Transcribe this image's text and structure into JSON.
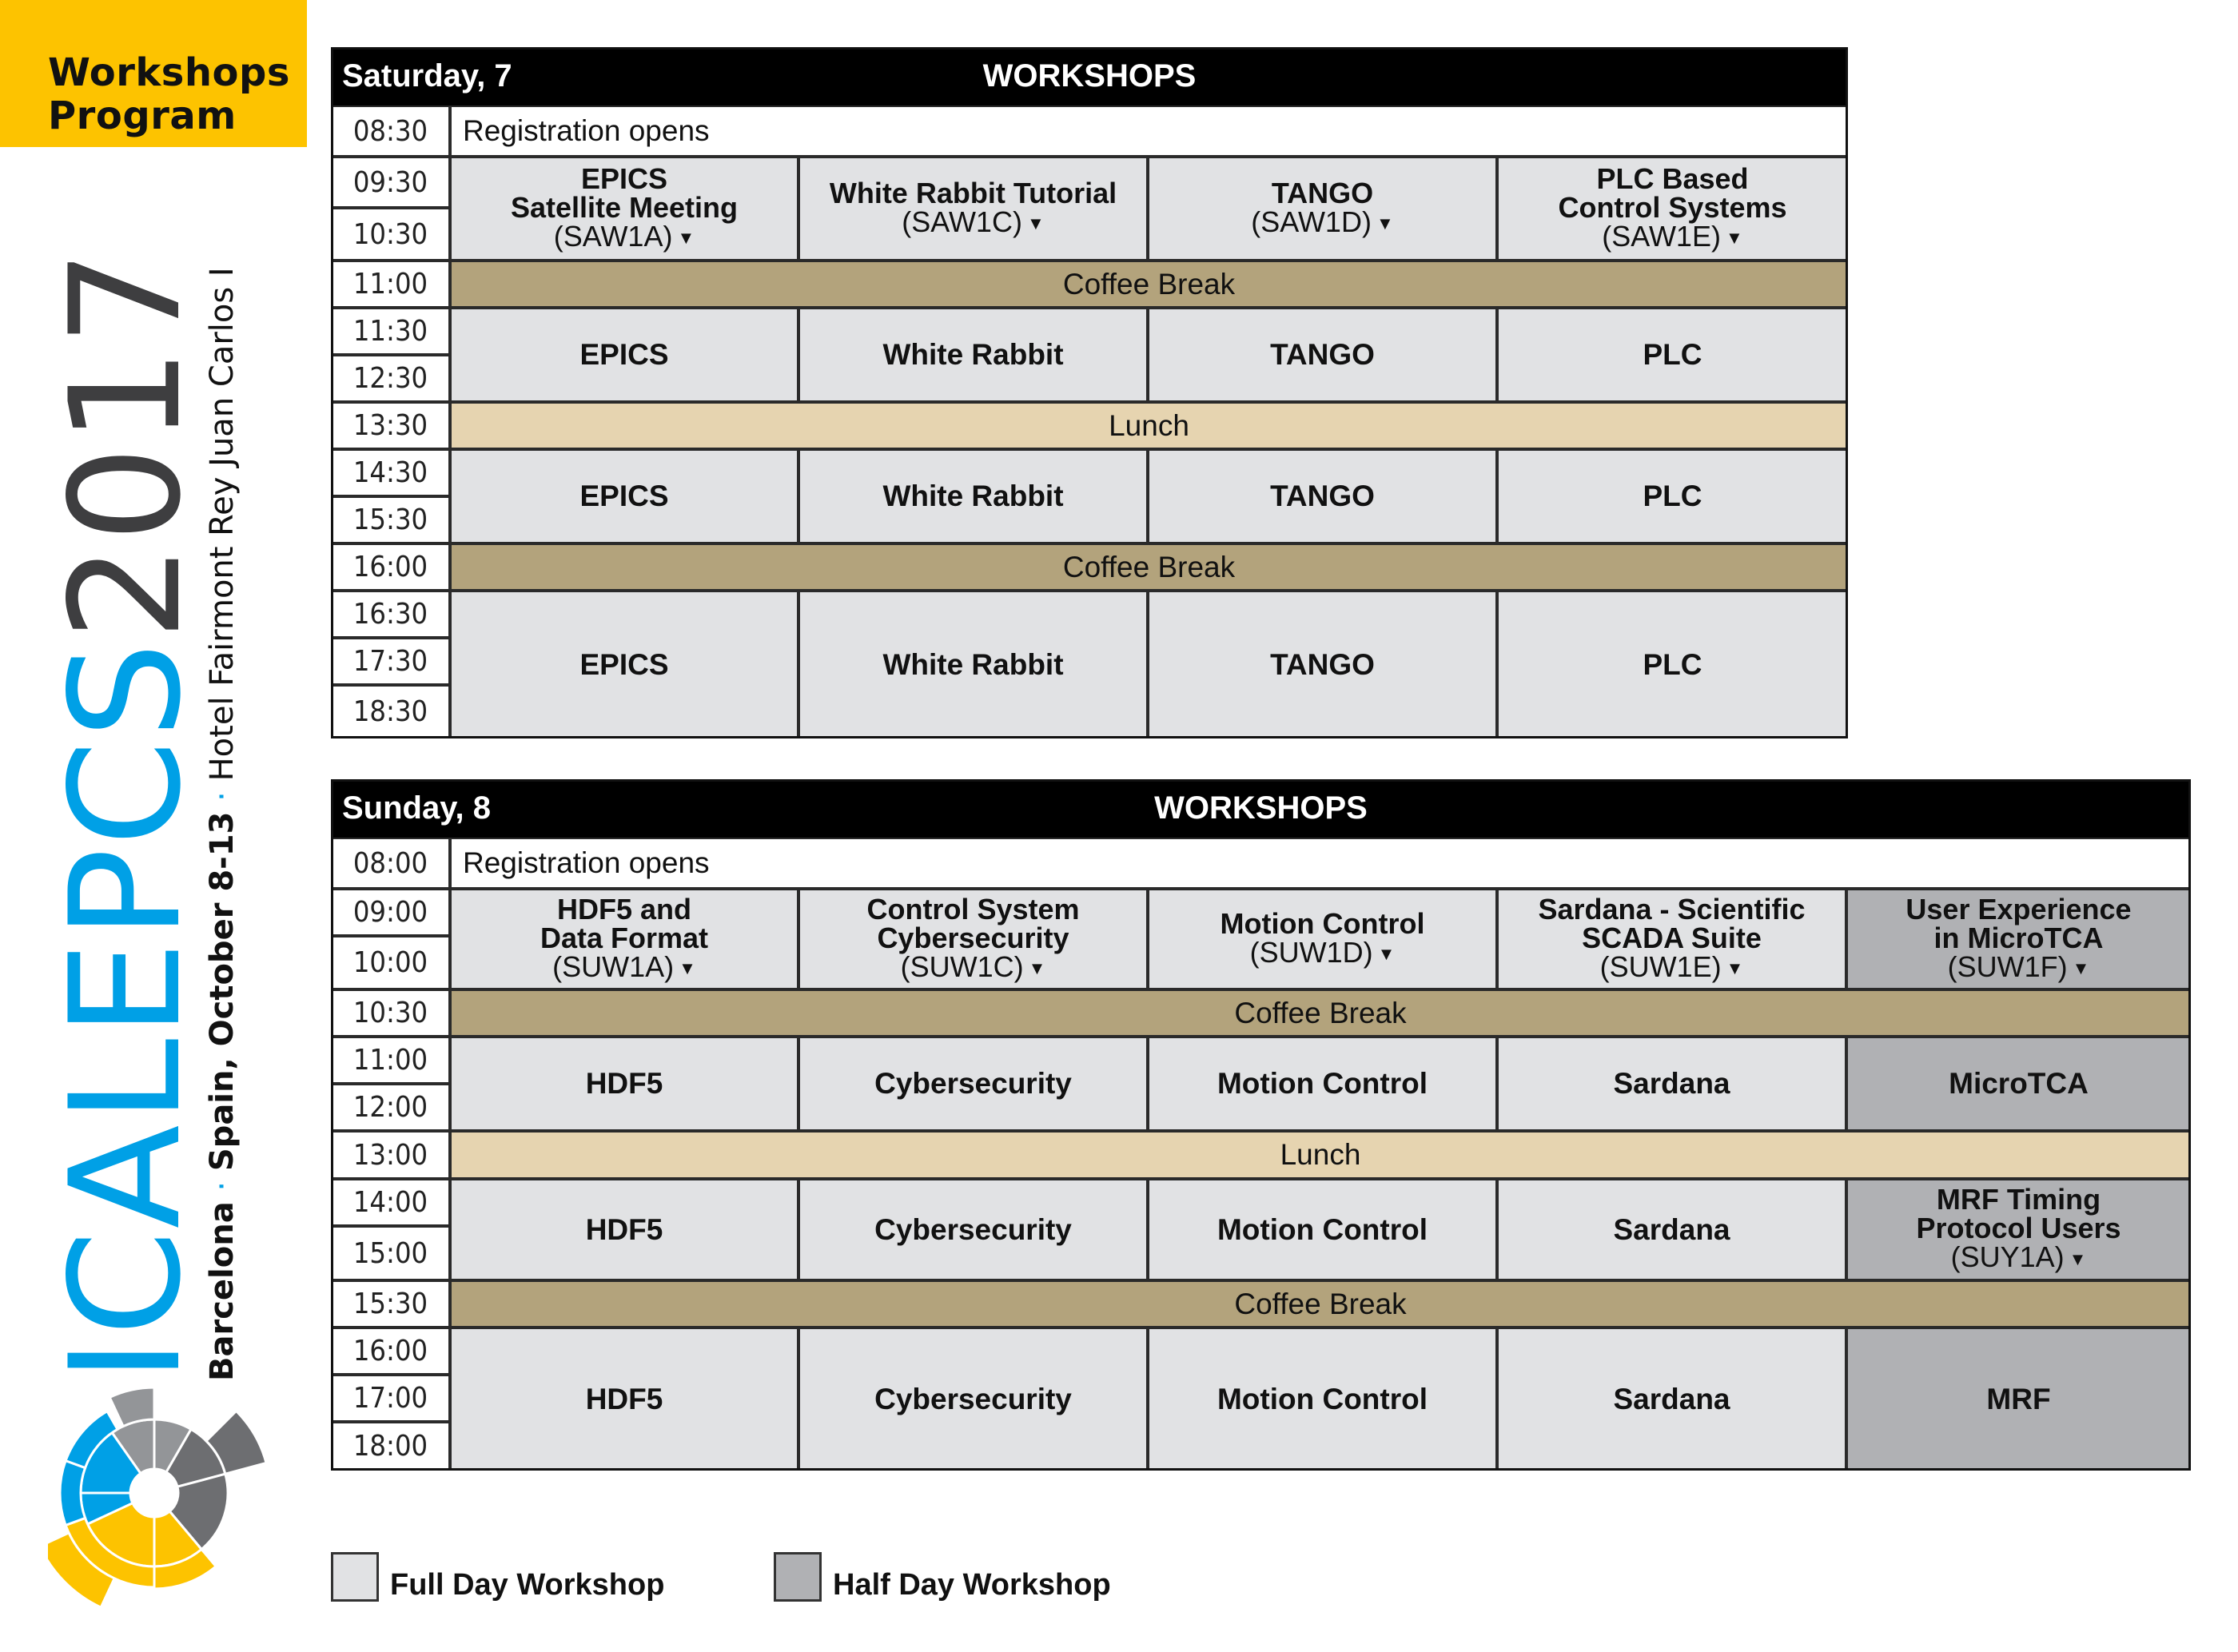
{
  "header": {
    "title_line1": "Workshops",
    "title_line2": "Program"
  },
  "branding": {
    "logo_part1": "ICALEP",
    "logo_part2": "CS",
    "logo_part3": "2017",
    "city": "Barcelona",
    "separator": "·",
    "dates": "Spain, October 8-13",
    "venue": "Hotel Fairmont Rey Juan Carlos I",
    "colors": {
      "blue": "#00a0e6",
      "dark": "#3e3e40",
      "yellow": "#fdc300",
      "grey": "#939598"
    }
  },
  "saturday": {
    "day": "Saturday, 7",
    "heading": "WORKSHOPS",
    "times": [
      "08:30",
      "09:30",
      "10:30",
      "11:00",
      "11:30",
      "12:30",
      "13:30",
      "14:30",
      "15:30",
      "16:00",
      "16:30",
      "17:30",
      "18:30"
    ],
    "registration": "Registration opens",
    "coffee": "Coffee Break",
    "lunch": "Lunch",
    "workshops": [
      {
        "title_lines": [
          "EPICS",
          "Satellite Meeting"
        ],
        "code": "(SAW1A)",
        "short": "EPICS",
        "type": "full"
      },
      {
        "title_lines": [
          "White Rabbit Tutorial"
        ],
        "code": "(SAW1C)",
        "short": "White Rabbit",
        "type": "full"
      },
      {
        "title_lines": [
          "TANGO"
        ],
        "code": "(SAW1D)",
        "short": "TANGO",
        "type": "full"
      },
      {
        "title_lines": [
          "PLC Based",
          "Control Systems"
        ],
        "code": "(SAW1E)",
        "short": "PLC",
        "type": "full"
      }
    ]
  },
  "sunday": {
    "day": "Sunday, 8",
    "heading": "WORKSHOPS",
    "times": [
      "08:00",
      "09:00",
      "10:00",
      "10:30",
      "11:00",
      "12:00",
      "13:00",
      "14:00",
      "15:00",
      "15:30",
      "16:00",
      "17:00",
      "18:00"
    ],
    "registration": "Registration opens",
    "coffee": "Coffee Break",
    "lunch": "Lunch",
    "workshops": [
      {
        "title_lines": [
          "HDF5 and",
          "Data Format"
        ],
        "code": "(SUW1A)",
        "short": "HDF5",
        "type": "full"
      },
      {
        "title_lines": [
          "Control System",
          "Cybersecurity"
        ],
        "code": "(SUW1C)",
        "short": "Cybersecurity",
        "type": "full"
      },
      {
        "title_lines": [
          "Motion Control"
        ],
        "code": "(SUW1D)",
        "short": "Motion Control",
        "type": "full"
      },
      {
        "title_lines": [
          "Sardana - Scientific",
          "SCADA Suite"
        ],
        "code": "(SUW1E)",
        "short": "Sardana",
        "type": "full"
      },
      {
        "title_lines": [
          "User Experience",
          "in MicroTCA"
        ],
        "code": "(SUW1F)",
        "short": "MicroTCA",
        "type": "half"
      }
    ],
    "afternoon_half": {
      "title_lines": [
        "MRF Timing",
        "Protocol Users"
      ],
      "code": "(SUY1A)",
      "short": "MRF",
      "type": "half"
    }
  },
  "legend": {
    "full_day": "Full Day Workshop",
    "half_day": "Half Day Workshop",
    "full_color": "#e1e2e4",
    "half_color": "#b0b1b4"
  },
  "arrow_glyph": "▼"
}
